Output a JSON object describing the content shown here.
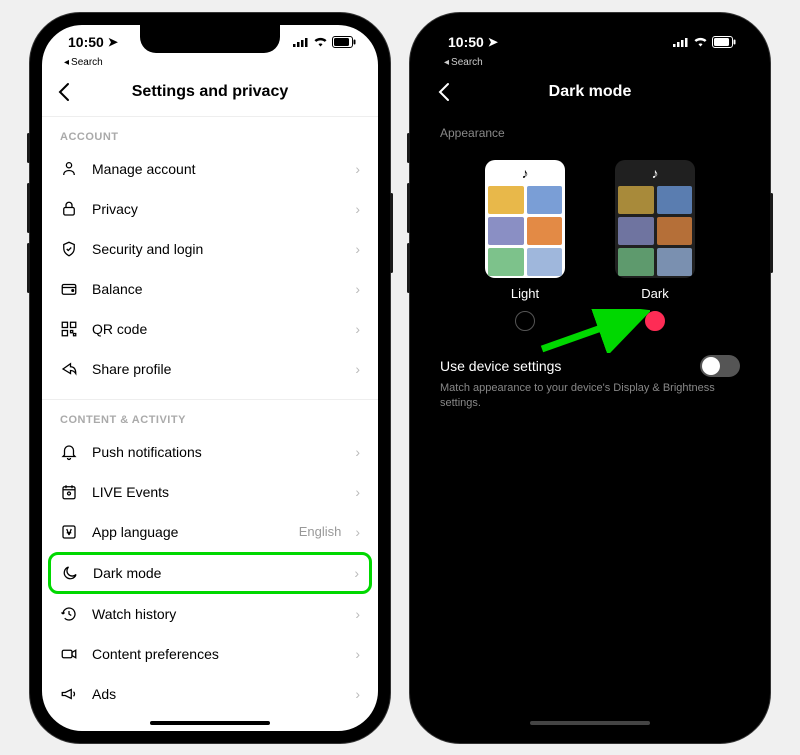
{
  "status": {
    "time": "10:50",
    "back_mini": "Search"
  },
  "settings": {
    "title": "Settings and privacy",
    "sections": [
      {
        "header": "ACCOUNT",
        "items": [
          {
            "icon": "person-icon",
            "label": "Manage account"
          },
          {
            "icon": "lock-icon",
            "label": "Privacy"
          },
          {
            "icon": "shield-icon",
            "label": "Security and login"
          },
          {
            "icon": "wallet-icon",
            "label": "Balance"
          },
          {
            "icon": "qr-icon",
            "label": "QR code"
          },
          {
            "icon": "share-icon",
            "label": "Share profile"
          }
        ]
      },
      {
        "header": "CONTENT & ACTIVITY",
        "items": [
          {
            "icon": "bell-icon",
            "label": "Push notifications"
          },
          {
            "icon": "calendar-icon",
            "label": "LIVE Events"
          },
          {
            "icon": "language-icon",
            "label": "App language",
            "value": "English"
          },
          {
            "icon": "moon-icon",
            "label": "Dark mode",
            "highlight": true
          },
          {
            "icon": "history-icon",
            "label": "Watch history"
          },
          {
            "icon": "video-icon",
            "label": "Content preferences"
          },
          {
            "icon": "megaphone-icon",
            "label": "Ads"
          }
        ]
      }
    ]
  },
  "darkmode": {
    "title": "Dark mode",
    "appearance_header": "Appearance",
    "options": [
      {
        "label": "Light",
        "selected": false
      },
      {
        "label": "Dark",
        "selected": true
      }
    ],
    "use_device_label": "Use device settings",
    "use_device_desc": "Match appearance to your device's Display & Brightness settings.",
    "use_device_on": false
  },
  "colors": {
    "accent": "#fe2c55",
    "highlight": "#00d800"
  }
}
